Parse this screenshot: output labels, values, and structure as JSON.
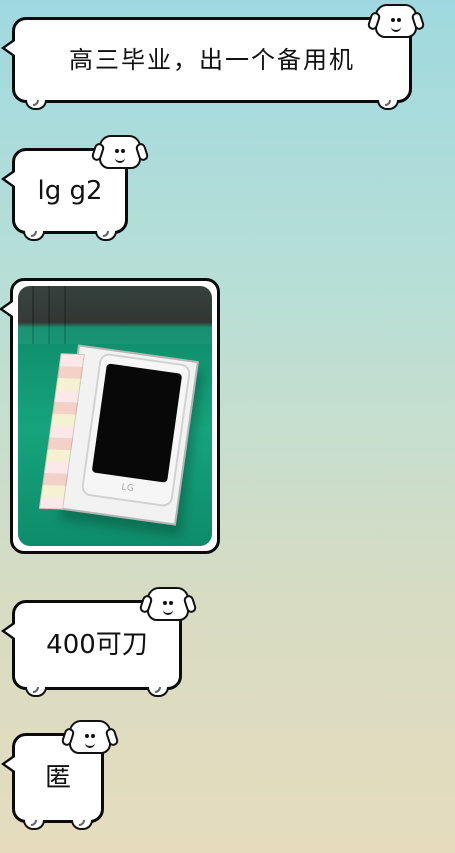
{
  "chat": {
    "messages": [
      {
        "type": "text",
        "text": "高三毕业，出一个备用机"
      },
      {
        "type": "text",
        "text": "lg g2"
      },
      {
        "type": "image",
        "image_alt": "LG G2"
      },
      {
        "type": "text",
        "text": "400可刀"
      },
      {
        "type": "text",
        "text": "匿"
      }
    ]
  },
  "theme": {
    "bubble_fill": "#ffffff",
    "bubble_stroke": "#0b0b0b",
    "text_color": "#111111"
  }
}
